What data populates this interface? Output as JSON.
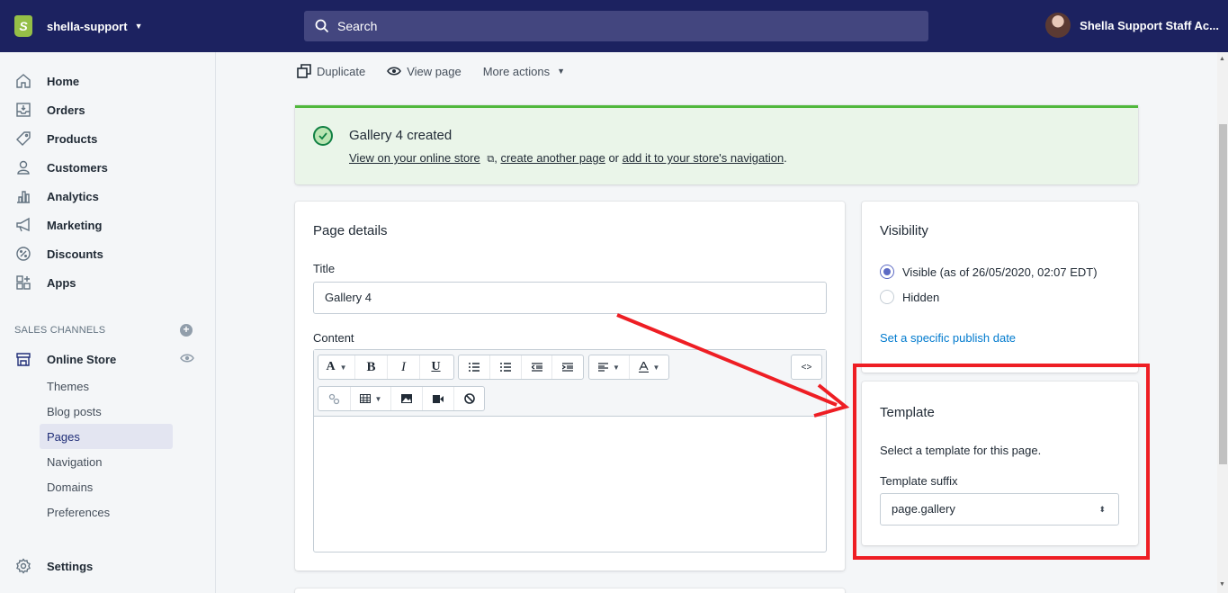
{
  "topbar": {
    "store_name": "shella-support",
    "search_placeholder": "Search",
    "user_name": "Shella Support Staff Ac..."
  },
  "sidebar": {
    "items": [
      {
        "label": "Home",
        "icon": "home-icon"
      },
      {
        "label": "Orders",
        "icon": "orders-icon"
      },
      {
        "label": "Products",
        "icon": "tag-icon"
      },
      {
        "label": "Customers",
        "icon": "person-icon"
      },
      {
        "label": "Analytics",
        "icon": "bar-chart-icon"
      },
      {
        "label": "Marketing",
        "icon": "megaphone-icon"
      },
      {
        "label": "Discounts",
        "icon": "discount-icon"
      },
      {
        "label": "Apps",
        "icon": "apps-icon"
      }
    ],
    "sales_channels_title": "SALES CHANNELS",
    "online_store_label": "Online Store",
    "subitems": [
      "Themes",
      "Blog posts",
      "Pages",
      "Navigation",
      "Domains",
      "Preferences"
    ],
    "active_subitem": "Pages",
    "settings_label": "Settings"
  },
  "actions": {
    "duplicate": "Duplicate",
    "view_page": "View page",
    "more_actions": "More actions"
  },
  "banner": {
    "title": "Gallery 4 created",
    "link_view": "View on your online store",
    "sep1": ", ",
    "link_create": "create another page",
    "sep2": " or ",
    "link_nav": "add it to your store's navigation",
    "end": "."
  },
  "page_details": {
    "title": "Page details",
    "title_label": "Title",
    "title_value": "Gallery 4",
    "content_label": "Content",
    "toolbar": {
      "font": "A",
      "bold": "B",
      "italic": "I",
      "underline": "U",
      "html": "<>"
    }
  },
  "visibility": {
    "title": "Visibility",
    "visible_label": "Visible (as of 26/05/2020, 02:07 EDT)",
    "hidden_label": "Hidden",
    "selected": "Visible (as of 26/05/2020, 02:07 EDT)",
    "publish_link": "Set a specific publish date"
  },
  "template": {
    "title": "Template",
    "description": "Select a template for this page.",
    "suffix_label": "Template suffix",
    "suffix_value": "page.gallery"
  },
  "colors": {
    "topbar": "#1c2260",
    "accent": "#5c6ac4",
    "success": "#50b83c",
    "annotation": "#ee1e24",
    "link": "#007ace"
  }
}
